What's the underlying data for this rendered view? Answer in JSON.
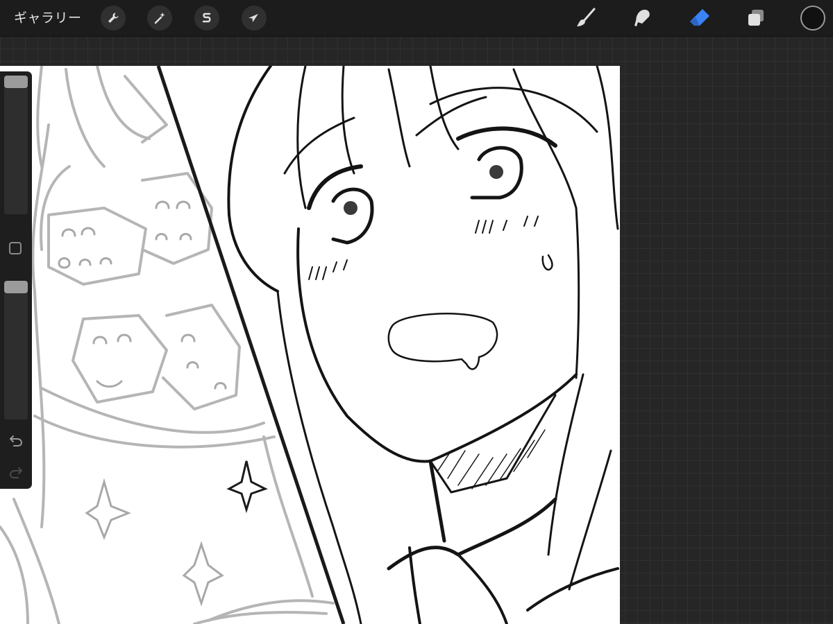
{
  "topbar": {
    "gallery_label": "ギャラリー",
    "left_tools": [
      {
        "name": "actions",
        "icon": "wrench-icon"
      },
      {
        "name": "adjustments",
        "icon": "magic-wand-icon"
      },
      {
        "name": "selection",
        "icon": "selection-s-icon"
      },
      {
        "name": "transform",
        "icon": "arrow-cursor-icon"
      }
    ],
    "right_tools": [
      {
        "name": "brush",
        "icon": "brush-icon",
        "active": false
      },
      {
        "name": "smudge",
        "icon": "smudge-icon",
        "active": false
      },
      {
        "name": "eraser",
        "icon": "eraser-icon",
        "active": true
      },
      {
        "name": "layers",
        "icon": "layers-icon",
        "active": false
      }
    ],
    "current_color": "#111111"
  },
  "sidebar": {
    "brush_size_slider": {
      "level": 0.0
    },
    "opacity_slider": {
      "level": 0.0
    },
    "modify_button_icon": "square-icon",
    "undo_icon": "undo-icon",
    "redo_icon": "redo-icon"
  },
  "colors": {
    "accent": "#3a82f7",
    "topbar_bg": "#1c1c1c",
    "workspace_bg": "#262626",
    "canvas_bg": "#ffffff"
  }
}
